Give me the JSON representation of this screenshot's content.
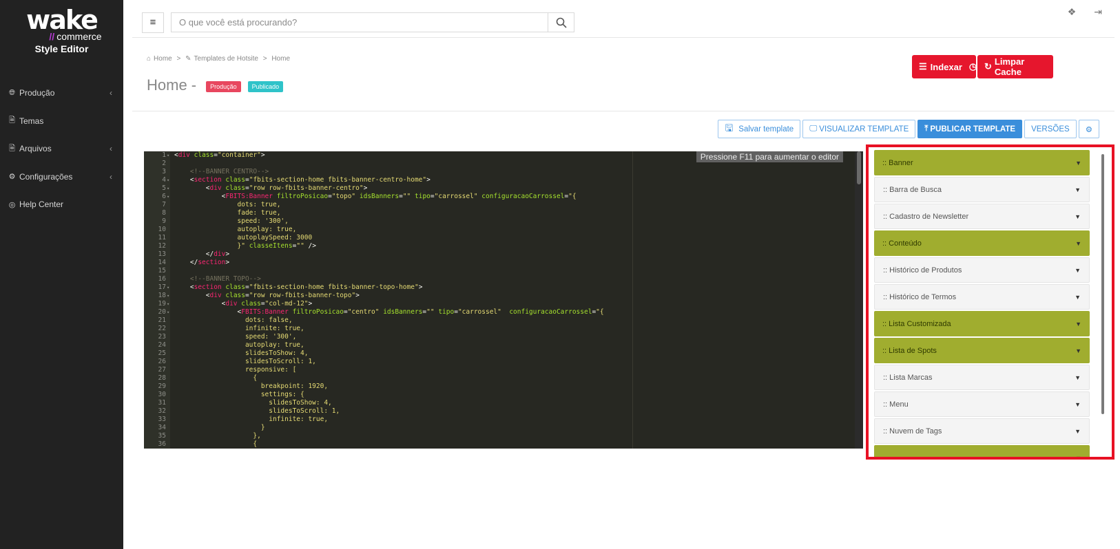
{
  "sidebar": {
    "logo_main": "wake",
    "logo_slash": "//",
    "logo_sub": "commerce",
    "app_name": "Style Editor",
    "items": [
      {
        "label": "Produção",
        "icon": "globe-icon",
        "has_children": true
      },
      {
        "label": "Temas",
        "icon": "file-icon",
        "has_children": false
      },
      {
        "label": "Arquivos",
        "icon": "file-text-icon",
        "has_children": true
      },
      {
        "label": "Configurações",
        "icon": "cogs-icon",
        "has_children": true
      },
      {
        "label": "Help Center",
        "icon": "life-ring-icon",
        "has_children": false
      }
    ]
  },
  "topbar": {
    "search_placeholder": "O que você está procurando?"
  },
  "breadcrumb": {
    "items": [
      "Home",
      ">",
      "Templates de Hotsite",
      ">",
      "Home"
    ]
  },
  "page": {
    "title": "Home -",
    "badge_environment": "Produção",
    "badge_status": "Publicado"
  },
  "actions": {
    "index_label": "Indexar",
    "clear_cache_label": "Limpar Cache"
  },
  "toolbar": {
    "save_label": "Salvar template",
    "preview_label": "VISUALIZAR TEMPLATE",
    "publish_label": "PUBLICAR TEMPLATE",
    "versions_label": "VERSÕES"
  },
  "editor": {
    "hint": "Pressione F11 para aumentar o editor",
    "lines": [
      {
        "n": "1",
        "fold": true,
        "html": "<span class=\"w\">&lt;</span><span class=\"t\">div</span> <span class=\"a\">class</span>=<span class=\"s\">\"container\"</span><span class=\"w\">&gt;</span>"
      },
      {
        "n": "2",
        "fold": false,
        "html": ""
      },
      {
        "n": "3",
        "fold": false,
        "html": "    <span class=\"c\">&lt;!--BANNER CENTRO--&gt;</span>"
      },
      {
        "n": "4",
        "fold": true,
        "html": "    &lt;<span class=\"t\">section</span> <span class=\"a\">class</span>=<span class=\"s\">\"fbits-section-home fbits-banner-centro-home\"</span>&gt;"
      },
      {
        "n": "5",
        "fold": true,
        "html": "        &lt;<span class=\"t\">div</span> <span class=\"a\">class</span>=<span class=\"s\">\"row row-fbits-banner-centro\"</span>&gt;"
      },
      {
        "n": "6",
        "fold": true,
        "html": "            &lt;<span class=\"t\">FBITS:Banner</span> <span class=\"a\">filtroPosicao</span>=<span class=\"s\">\"topo\"</span> <span class=\"a\">idsBanners</span>=<span class=\"s\">\"\"</span> <span class=\"a\">tipo</span>=<span class=\"s\">\"carrossel\"</span> <span class=\"a\">configuracaoCarrossel</span>=<span class=\"s\">\"{</span>"
      },
      {
        "n": "7",
        "fold": false,
        "html": "<span class=\"s\">                dots: true,</span>"
      },
      {
        "n": "8",
        "fold": false,
        "html": "<span class=\"s\">                fade: true,</span>"
      },
      {
        "n": "9",
        "fold": false,
        "html": "<span class=\"s\">                speed: '300',</span>"
      },
      {
        "n": "10",
        "fold": false,
        "html": "<span class=\"s\">                autoplay: true,</span>"
      },
      {
        "n": "11",
        "fold": false,
        "html": "<span class=\"s\">                autoplaySpeed: 3000</span>"
      },
      {
        "n": "12",
        "fold": false,
        "html": "<span class=\"s\">                }\"</span> <span class=\"a\">classeItens</span>=<span class=\"s\">\"\"</span> /&gt;"
      },
      {
        "n": "13",
        "fold": false,
        "html": "        &lt;/<span class=\"t\">div</span>&gt;"
      },
      {
        "n": "14",
        "fold": false,
        "html": "    &lt;/<span class=\"t\">section</span>&gt;"
      },
      {
        "n": "15",
        "fold": false,
        "html": ""
      },
      {
        "n": "16",
        "fold": false,
        "html": "    <span class=\"c\">&lt;!--BANNER TOPO--&gt;</span>"
      },
      {
        "n": "17",
        "fold": true,
        "html": "    &lt;<span class=\"t\">section</span> <span class=\"a\">class</span>=<span class=\"s\">\"fbits-section-home fbits-banner-topo-home\"</span>&gt;"
      },
      {
        "n": "18",
        "fold": true,
        "html": "        &lt;<span class=\"t\">div</span> <span class=\"a\">class</span>=<span class=\"s\">\"row row-fbits-banner-topo\"</span>&gt;"
      },
      {
        "n": "19",
        "fold": true,
        "html": "            &lt;<span class=\"t\">div</span> <span class=\"a\">class</span>=<span class=\"s\">\"col-md-12\"</span>&gt;"
      },
      {
        "n": "20",
        "fold": true,
        "html": "                &lt;<span class=\"t\">FBITS:Banner</span> <span class=\"a\">filtroPosicao</span>=<span class=\"s\">\"centro\"</span> <span class=\"a\">idsBanners</span>=<span class=\"s\">\"\"</span> <span class=\"a\">tipo</span>=<span class=\"s\">\"carrossel\"</span>  <span class=\"a\">configuracaoCarrossel</span>=<span class=\"s\">\"{</span>"
      },
      {
        "n": "21",
        "fold": false,
        "html": "<span class=\"s\">                  dots: false,</span>"
      },
      {
        "n": "22",
        "fold": false,
        "html": "<span class=\"s\">                  infinite: true,</span>"
      },
      {
        "n": "23",
        "fold": false,
        "html": "<span class=\"s\">                  speed: '300',</span>"
      },
      {
        "n": "24",
        "fold": false,
        "html": "<span class=\"s\">                  autoplay: true,</span>"
      },
      {
        "n": "25",
        "fold": false,
        "html": "<span class=\"s\">                  slidesToShow: 4,</span>"
      },
      {
        "n": "26",
        "fold": false,
        "html": "<span class=\"s\">                  slidesToScroll: 1,</span>"
      },
      {
        "n": "27",
        "fold": false,
        "html": "<span class=\"s\">                  responsive: [</span>"
      },
      {
        "n": "28",
        "fold": false,
        "html": "<span class=\"s\">                    {</span>"
      },
      {
        "n": "29",
        "fold": false,
        "html": "<span class=\"s\">                      breakpoint: 1920,</span>"
      },
      {
        "n": "30",
        "fold": false,
        "html": "<span class=\"s\">                      settings: {</span>"
      },
      {
        "n": "31",
        "fold": false,
        "html": "<span class=\"s\">                        slidesToShow: 4,</span>"
      },
      {
        "n": "32",
        "fold": false,
        "html": "<span class=\"s\">                        slidesToScroll: 1,</span>"
      },
      {
        "n": "33",
        "fold": false,
        "html": "<span class=\"s\">                        infinite: true,</span>"
      },
      {
        "n": "34",
        "fold": false,
        "html": "<span class=\"s\">                      }</span>"
      },
      {
        "n": "35",
        "fold": false,
        "html": "<span class=\"s\">                    },</span>"
      },
      {
        "n": "36",
        "fold": false,
        "html": "<span class=\"s\">                    {</span>"
      }
    ]
  },
  "components": [
    {
      "label": ":: Banner",
      "style": "green"
    },
    {
      "label": ":: Barra de Busca",
      "style": "gray"
    },
    {
      "label": ":: Cadastro de Newsletter",
      "style": "gray"
    },
    {
      "label": ":: Conteúdo",
      "style": "green"
    },
    {
      "label": ":: Histórico de Produtos",
      "style": "gray"
    },
    {
      "label": ":: Histórico de Termos",
      "style": "gray"
    },
    {
      "label": ":: Lista Customizada",
      "style": "green"
    },
    {
      "label": ":: Lista de Spots",
      "style": "green"
    },
    {
      "label": ":: Lista Marcas",
      "style": "gray"
    },
    {
      "label": ":: Menu",
      "style": "gray"
    },
    {
      "label": ":: Nuvem de Tags",
      "style": "gray"
    },
    {
      "label": "",
      "style": "green"
    }
  ],
  "colors": {
    "sidebar_bg": "#222222",
    "accent_red": "#e6162d",
    "primary_blue": "#3a8edb",
    "component_green": "#a0ad2f",
    "highlight_border": "#e81124"
  }
}
